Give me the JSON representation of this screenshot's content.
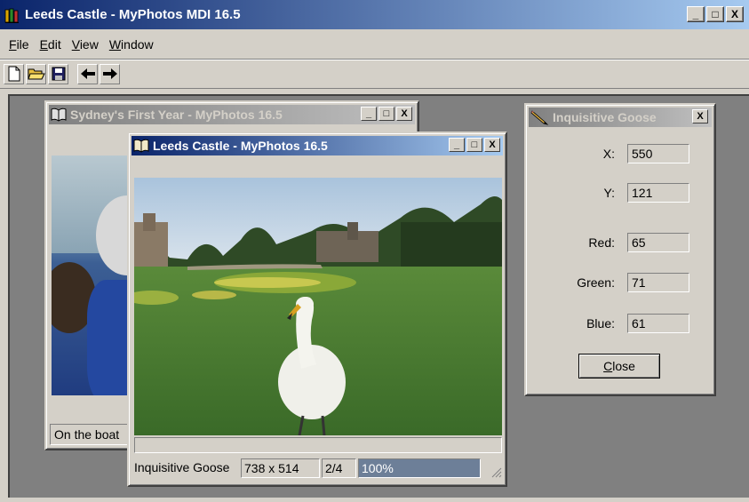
{
  "app": {
    "title": "Leeds Castle - MyPhotos MDI 16.5",
    "window_buttons": [
      "_",
      "□",
      "X"
    ]
  },
  "menu": {
    "items": [
      {
        "accel": "F",
        "rest": "ile"
      },
      {
        "accel": "E",
        "rest": "dit"
      },
      {
        "accel": "V",
        "rest": "iew"
      },
      {
        "accel": "W",
        "rest": "indow"
      }
    ]
  },
  "toolbar": {
    "buttons": [
      "new-file-icon",
      "open-folder-icon",
      "save-disk-icon",
      "back-arrow-icon",
      "forward-arrow-icon"
    ]
  },
  "sydney_window": {
    "title": "Sydney's First Year - MyPhotos 16.5",
    "caption": "On the boat"
  },
  "leeds_window": {
    "title": "Leeds Castle - MyPhotos 16.5",
    "status": {
      "caption": "Inquisitive Goose",
      "size": "738 x 514",
      "index": "2/4",
      "zoom": "100%"
    }
  },
  "pixel_dialog": {
    "title": "Inquisitive Goose",
    "fields": [
      {
        "label": "X:",
        "value": "550"
      },
      {
        "label": "Y:",
        "value": "121"
      },
      {
        "label": "Red:",
        "value": "65"
      },
      {
        "label": "Green:",
        "value": "71"
      },
      {
        "label": "Blue:",
        "value": "61"
      }
    ],
    "close_accel": "C",
    "close_rest": "lose"
  },
  "colors": {
    "active_title": "#0a246a",
    "inactive_title": "#808080",
    "mdi_background": "#808080",
    "face": "#d4d0c8"
  }
}
